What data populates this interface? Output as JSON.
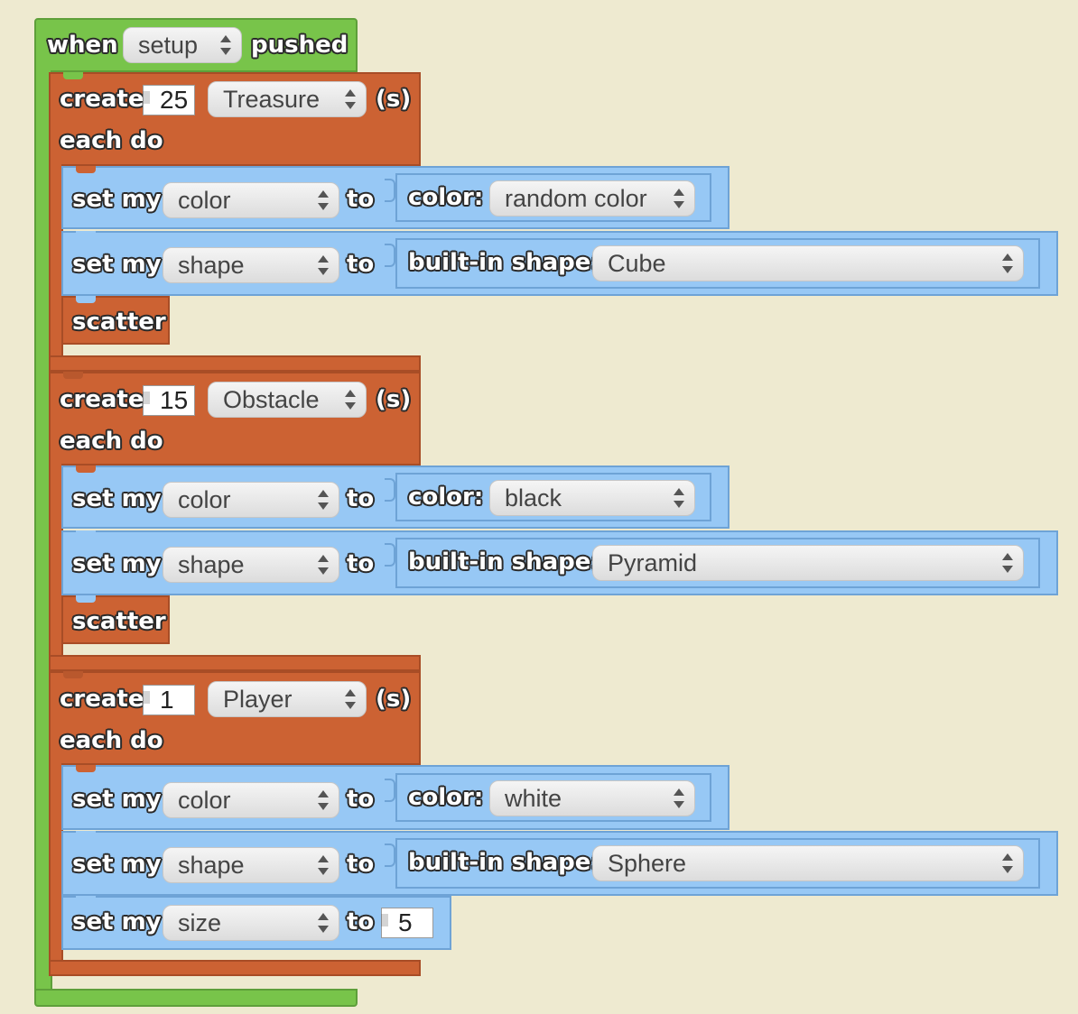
{
  "event_block": {
    "when_label": "when",
    "button_value": "setup",
    "pushed_label": "pushed"
  },
  "groups": [
    {
      "create_label": "create",
      "count": "25",
      "breed": "Treasure",
      "suffix_label": "(s)",
      "each_do_label": "each do",
      "color_row": {
        "set_label": "set my",
        "property": "color",
        "to_label": "to",
        "value_label": "color:",
        "value": "random color"
      },
      "shape_row": {
        "set_label": "set my",
        "property": "shape",
        "to_label": "to",
        "value_label": "built-in shape:",
        "value": "Cube"
      },
      "scatter_label": "scatter"
    },
    {
      "create_label": "create",
      "count": "15",
      "breed": "Obstacle",
      "suffix_label": "(s)",
      "each_do_label": "each do",
      "color_row": {
        "set_label": "set my",
        "property": "color",
        "to_label": "to",
        "value_label": "color:",
        "value": "black"
      },
      "shape_row": {
        "set_label": "set my",
        "property": "shape",
        "to_label": "to",
        "value_label": "built-in shape:",
        "value": "Pyramid"
      },
      "scatter_label": "scatter"
    },
    {
      "create_label": "create",
      "count": "1",
      "breed": "Player",
      "suffix_label": "(s)",
      "each_do_label": "each do",
      "color_row": {
        "set_label": "set my",
        "property": "color",
        "to_label": "to",
        "value_label": "color:",
        "value": "white"
      },
      "shape_row": {
        "set_label": "set my",
        "property": "shape",
        "to_label": "to",
        "value_label": "built-in shape:",
        "value": "Sphere"
      },
      "size_row": {
        "set_label": "set my",
        "property": "size",
        "to_label": "to",
        "value": "5"
      }
    }
  ],
  "colors": {
    "event_block": "#78c44a",
    "create_block": "#cc6233",
    "set_block": "#97c8f5",
    "workspace": "#eeead0"
  }
}
